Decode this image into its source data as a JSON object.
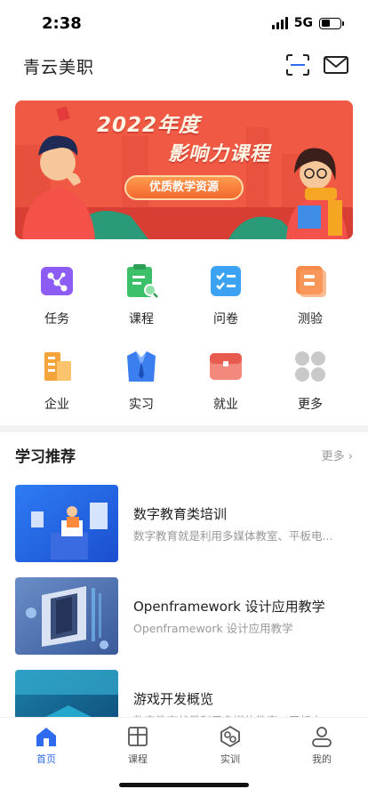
{
  "status": {
    "time": "2:38",
    "network": "5G"
  },
  "header": {
    "title": "青云美职",
    "scan_icon": "scan-icon",
    "mail_icon": "mail-icon"
  },
  "banner": {
    "line1": "2022年度",
    "line2": "影响力课程",
    "pill": "优质教学资源"
  },
  "grid": [
    {
      "label": "任务",
      "icon": "task-icon"
    },
    {
      "label": "课程",
      "icon": "course-icon"
    },
    {
      "label": "问卷",
      "icon": "survey-icon"
    },
    {
      "label": "测验",
      "icon": "quiz-icon"
    },
    {
      "label": "企业",
      "icon": "company-icon"
    },
    {
      "label": "实习",
      "icon": "internship-icon"
    },
    {
      "label": "就业",
      "icon": "employment-icon"
    },
    {
      "label": "更多",
      "icon": "more-icon"
    }
  ],
  "section": {
    "title": "学习推荐",
    "more": "更多 ›"
  },
  "courses": [
    {
      "title": "数字教育类培训",
      "desc": "数字教育就是利用多媒体教室、平板电..."
    },
    {
      "title": "Openframework 设计应用教学",
      "desc": "Openframework 设计应用教学"
    },
    {
      "title": "游戏开发概览",
      "desc": "数字教育就是利用多媒体教室、平板电..."
    }
  ],
  "tabbar": [
    {
      "label": "首页",
      "icon": "home-icon",
      "active": true
    },
    {
      "label": "课程",
      "icon": "book-icon",
      "active": false
    },
    {
      "label": "实训",
      "icon": "training-icon",
      "active": false
    },
    {
      "label": "我的",
      "icon": "profile-icon",
      "active": false
    }
  ],
  "colors": {
    "accent": "#2f6bf0",
    "banner": "#f05a45"
  }
}
